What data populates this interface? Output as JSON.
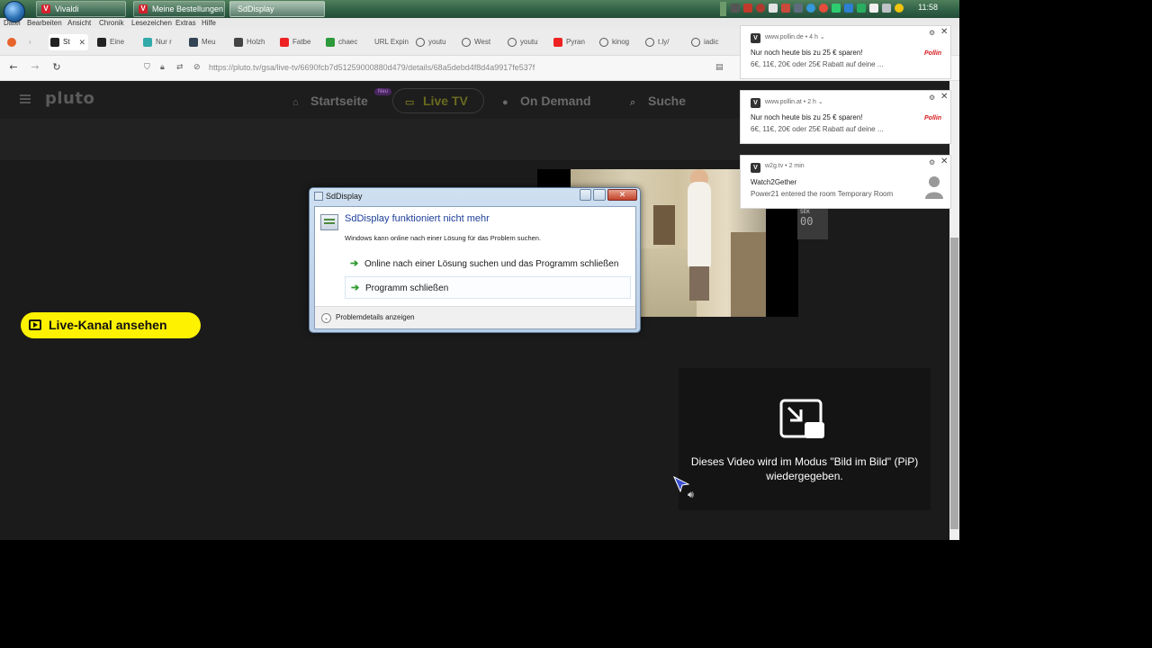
{
  "taskbar": {
    "buttons": [
      {
        "label": "Vivaldi"
      },
      {
        "label": "Meine Bestellungen ..."
      },
      {
        "label": "SdDisplay"
      }
    ],
    "clock": "11:58"
  },
  "menubar": {
    "items": [
      "Datei",
      "Bearbeiten",
      "Ansicht",
      "Chronik",
      "Lesezeichen",
      "Extras",
      "Hilfe"
    ]
  },
  "tabs": [
    {
      "label": "St",
      "active": true
    },
    {
      "label": "Eine"
    },
    {
      "label": "Nur r"
    },
    {
      "label": "Meu"
    },
    {
      "label": "Holzh"
    },
    {
      "label": "Fatbe"
    },
    {
      "label": "chaec"
    },
    {
      "label": "URL Expin"
    },
    {
      "label": "youtu"
    },
    {
      "label": "West"
    },
    {
      "label": "youtu"
    },
    {
      "label": "Pyran"
    },
    {
      "label": "kinog"
    },
    {
      "label": "t.ly/"
    },
    {
      "label": "iadic"
    }
  ],
  "address": {
    "url": "https://pluto.tv/gsa/live-tv/6690fcb7d51259000880d479/details/68a5debd4f8d4a9917fe537f"
  },
  "pluto": {
    "logo": "pluto",
    "nav": [
      {
        "label": "Startseite",
        "icon": "home-icon"
      },
      {
        "label": "Live TV",
        "icon": "tv-icon"
      },
      {
        "label": "On Demand",
        "icon": "play-circle-icon"
      },
      {
        "label": "Suche",
        "icon": "search-icon"
      }
    ],
    "new_badge": "Neu",
    "live_button": "Live-Kanal ansehen",
    "sek_label": "SEK",
    "sek_value": "00",
    "pip_text": "Dieses Video wird im Modus \"Bild im Bild\" (PiP) wiedergegeben."
  },
  "notifications": [
    {
      "source": "www.pollin.de",
      "age": "4 h",
      "title": "Nur noch heute bis zu 25 € sparen!",
      "body": "6€, 11€, 20€ oder 25€ Rabatt auf deine ...",
      "logo": "Pollin"
    },
    {
      "source": "www.pollin.at",
      "age": "2 h",
      "title": "Nur noch heute bis zu 25 € sparen!",
      "body": "6€, 11€, 20€ oder 25€ Rabatt auf deine ...",
      "logo": "Pollin"
    },
    {
      "source": "w2g.tv",
      "age": "2 min",
      "title": "Watch2Gether",
      "body": "Power21 entered the room Temporary Room"
    }
  ],
  "dialog": {
    "title": "SdDisplay",
    "heading": "SdDisplay funktioniert nicht mehr",
    "subtext": "Windows kann online nach einer Lösung für das Problem suchen.",
    "option1": "Online nach einer Lösung suchen und das Programm schließen",
    "option2": "Programm schließen",
    "details": "Problemdetails anzeigen"
  },
  "colors": {
    "accent_yellow": "#fff200",
    "dialog_heading": "#1e3f99",
    "pollin_red": "#d71a21"
  }
}
